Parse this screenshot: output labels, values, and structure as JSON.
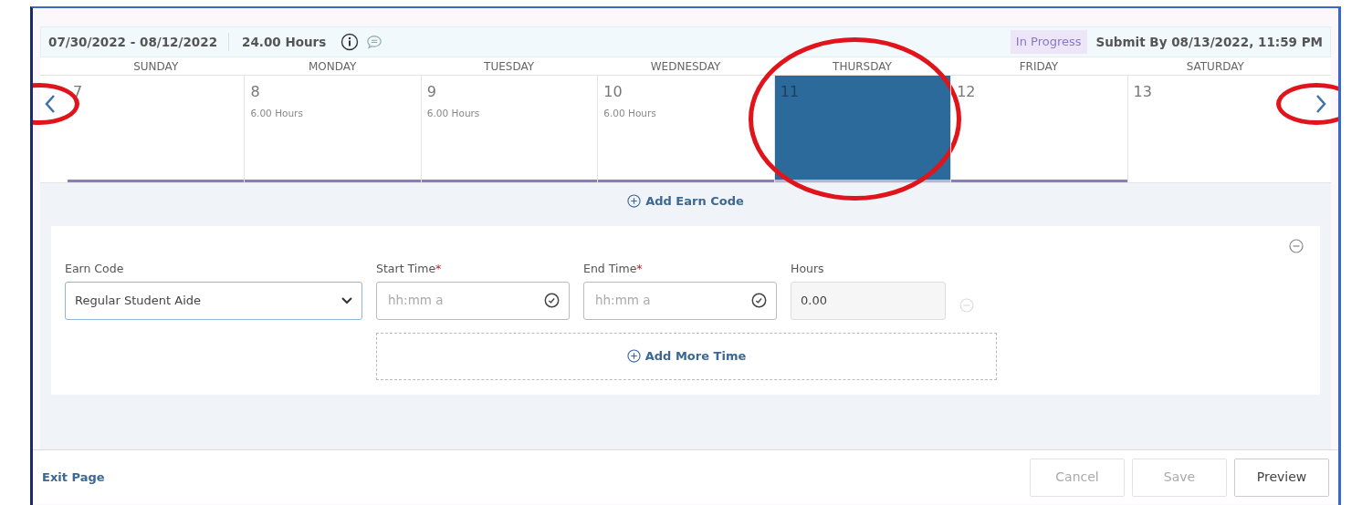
{
  "header": {
    "period": "07/30/2022 - 08/12/2022",
    "total_hours": "24.00 Hours",
    "status": "In Progress",
    "submit_by": "Submit By 08/13/2022, 11:59 PM"
  },
  "week_nav": {
    "prev_circled": true,
    "next_circled": true
  },
  "days": [
    {
      "weekday": "SUNDAY",
      "date": "7",
      "selected": false,
      "has_entry_bar": true,
      "circled": false
    },
    {
      "weekday": "MONDAY",
      "date": "8",
      "hours": "6.00 Hours",
      "selected": false,
      "has_entry_bar": true,
      "circled": false
    },
    {
      "weekday": "TUESDAY",
      "date": "9",
      "hours": "6.00 Hours",
      "selected": false,
      "has_entry_bar": true,
      "circled": false
    },
    {
      "weekday": "WEDNESDAY",
      "date": "10",
      "hours": "6.00 Hours",
      "selected": false,
      "has_entry_bar": true,
      "circled": false
    },
    {
      "weekday": "THURSDAY",
      "date": "11",
      "selected": true,
      "has_entry_bar": true,
      "circled": true
    },
    {
      "weekday": "FRIDAY",
      "date": "12",
      "selected": false,
      "has_entry_bar": true,
      "circled": false
    },
    {
      "weekday": "SATURDAY",
      "date": "13",
      "selected": false,
      "has_entry_bar": false,
      "circled": false
    }
  ],
  "add_earn_code": "Add Earn Code",
  "entry": {
    "earn_code_label": "Earn Code",
    "earn_code_value": "Regular Student Aide",
    "start_label": "Start Time",
    "start_placeholder": "hh:mm a",
    "end_label": "End Time",
    "end_placeholder": "hh:mm a",
    "required_mark": "*",
    "hours_label": "Hours",
    "hours_value": "0.00",
    "add_more_time": "Add More Time"
  },
  "footer": {
    "exit": "Exit Page",
    "buttons": [
      {
        "label": "Cancel",
        "disabled": true
      },
      {
        "label": "Save",
        "disabled": true
      },
      {
        "label": "Preview",
        "disabled": false
      }
    ]
  }
}
